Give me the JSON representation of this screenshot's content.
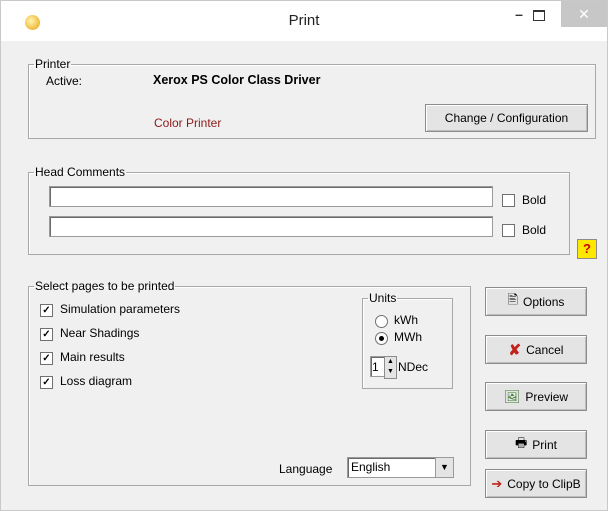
{
  "window": {
    "title": "Print",
    "min_glyph": "–",
    "close_glyph": "✕"
  },
  "printer": {
    "legend": "Printer",
    "active_label": "Active:",
    "driver": "Xerox PS Color Class Driver",
    "type": "Color Printer",
    "change_button": "Change / Configuration"
  },
  "head_comments": {
    "legend": "Head Comments",
    "line1": "",
    "line2": "",
    "bold1_label": "Bold",
    "bold2_label": "Bold"
  },
  "help_glyph": "?",
  "pages": {
    "legend": "Select pages to be printed",
    "items": [
      {
        "label": "Simulation parameters",
        "checked": true
      },
      {
        "label": "Near Shadings",
        "checked": true
      },
      {
        "label": "Main results",
        "checked": true
      },
      {
        "label": "Loss diagram",
        "checked": true
      }
    ],
    "units": {
      "legend": "Units",
      "options": [
        {
          "label": "kWh",
          "selected": false
        },
        {
          "label": "MWh",
          "selected": true
        }
      ],
      "ndec_value": "1",
      "ndec_label": "NDec"
    },
    "language_label": "Language",
    "language_value": "English"
  },
  "buttons": {
    "options": "Options",
    "cancel": "Cancel",
    "preview": "Preview",
    "print": "Print",
    "copy": "Copy to ClipB"
  },
  "colors": {
    "printer_type": "#8b1a1a",
    "cancel_x": "#c0231c",
    "help_bg": "#ffe800"
  }
}
